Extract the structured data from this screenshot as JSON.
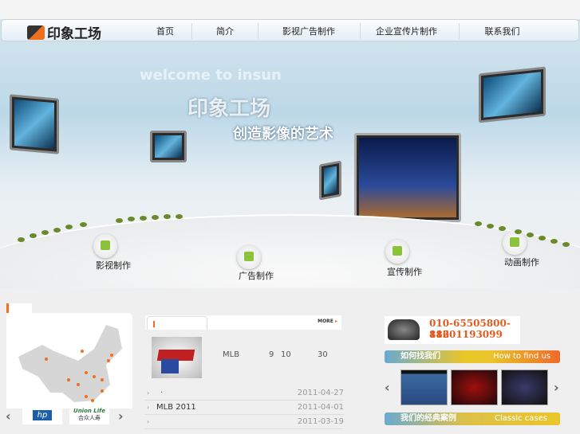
{
  "logo": {
    "text": "印象工场"
  },
  "nav": [
    "首页",
    "简介",
    "影视广告制作",
    "企业宣传片制作",
    "联系我们"
  ],
  "hero": {
    "welcome": "welcome to insun",
    "title": "印象工场",
    "slogan": "创造影像的艺术",
    "labels": [
      "影视制作",
      "广告制作",
      "宣传制作",
      "动画制作"
    ]
  },
  "partners": {
    "hp": "hp",
    "union": "Union Life",
    "union_cn": "合众人寿"
  },
  "news": {
    "more": "MORE",
    "feature": {
      "text": "MLB",
      "n1": "9",
      "n2": "10",
      "n3": "30"
    },
    "items": [
      {
        "title": "·",
        "date": "2011-04-27"
      },
      {
        "title": "MLB 2011",
        "date": "2011-04-01"
      },
      {
        "title": "",
        "date": "2011-03-19"
      }
    ]
  },
  "contact": {
    "phone1": "010-65505800-812",
    "phone2": "18601193099"
  },
  "find": {
    "cn": "如何找我们",
    "en": "How to find us"
  },
  "cases": {
    "cn": "我们的经典案例",
    "en": "Classic cases"
  }
}
